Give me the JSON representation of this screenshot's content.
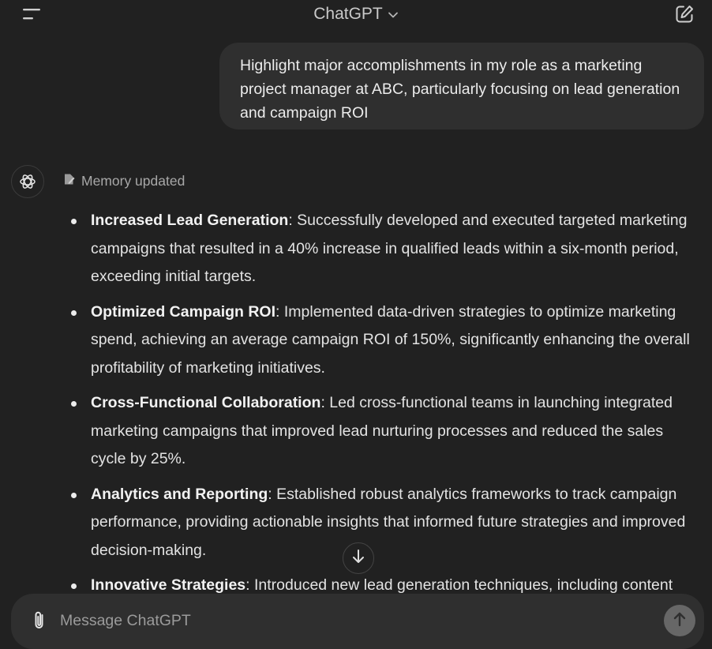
{
  "header": {
    "title": "ChatGPT",
    "menu_icon": "menu-icon",
    "chevron_icon": "chevron-down-icon",
    "new_chat_icon": "edit-icon"
  },
  "user_message": {
    "text": "Highlight major accomplishments in my role as a marketing project manager at ABC, particularly focusing on lead generation and campaign ROI"
  },
  "assistant": {
    "avatar_icon": "openai-logo-icon",
    "memory_label": "Memory updated",
    "items": [
      {
        "title": "Increased Lead Generation",
        "text": ": Successfully developed and executed targeted marketing campaigns that resulted in a 40% increase in qualified leads within a six-month period, exceeding initial targets."
      },
      {
        "title": "Optimized Campaign ROI",
        "text": ": Implemented data-driven strategies to optimize marketing spend, achieving an average campaign ROI of 150%, significantly enhancing the overall profitability of marketing initiatives."
      },
      {
        "title": "Cross-Functional Collaboration",
        "text": ": Led cross-functional teams in launching integrated marketing campaigns that improved lead nurturing processes and reduced the sales cycle by 25%."
      },
      {
        "title": "Analytics and Reporting",
        "text": ": Established robust analytics frameworks to track campaign performance, providing actionable insights that informed future strategies and improved decision-making."
      },
      {
        "title": "Innovative Strategies",
        "text": ": Introduced new lead generation techniques, including content"
      }
    ]
  },
  "composer": {
    "placeholder": "Message ChatGPT",
    "attach_icon": "paperclip-icon",
    "send_icon": "arrow-up-icon"
  },
  "scroll_button_icon": "arrow-down-icon",
  "colors": {
    "background": "#212121",
    "bubble": "#2f2f2f",
    "text": "#ececec",
    "muted": "#9b9b9b",
    "send_button": "#676767"
  }
}
